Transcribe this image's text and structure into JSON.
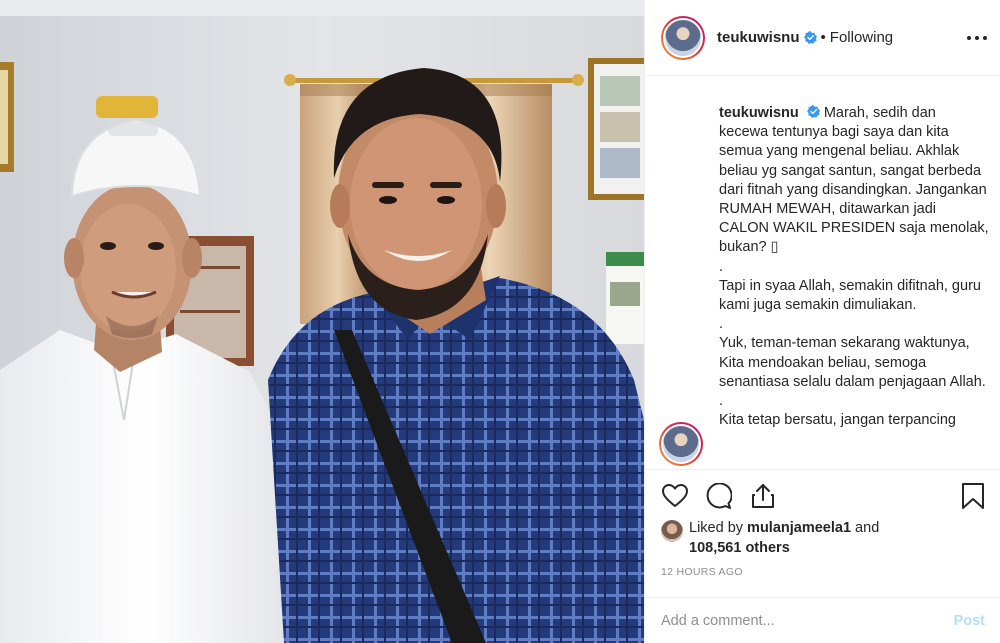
{
  "post": {
    "username": "teukuwisnu",
    "follow_separator": "•",
    "follow_status": "Following",
    "more_icon": "more-options-icon"
  },
  "caption": {
    "username": "teukuwisnu",
    "text_1": "Marah, sedih dan kecewa tentunya bagi saya dan kita semua yang mengenal beliau. Akhlak beliau yg sangat santun, sangat berbeda dari fitnah yang disandingkan. Jangankan RUMAH MEWAH, ditawarkan jadi CALON WAKIL PRESIDEN saja menolak, bukan? ▯",
    "dot_1": ".",
    "text_2": "Tapi in syaa Allah, semakin difitnah, guru kami juga semakin dimuliakan.",
    "dot_2": ".",
    "text_3": "Yuk, teman-teman sekarang waktunya, Kita mendoakan beliau, semoga senantiasa selalu dalam penjagaan Allah.",
    "dot_3": ".",
    "text_4": "Kita tetap bersatu, jangan terpancing"
  },
  "actions": {
    "like_icon": "heart-icon",
    "comment_icon": "comment-icon",
    "share_icon": "share-icon",
    "save_icon": "bookmark-icon"
  },
  "likes": {
    "prefix": "Liked by ",
    "liker": "mulanjameela1",
    "and": " and",
    "others": "108,561 others"
  },
  "timestamp": "12 HOURS AGO",
  "comment": {
    "placeholder": "Add a comment...",
    "post_label": "Post"
  },
  "colors": {
    "verified_blue": "#3897f0",
    "post_button": "#b2dffc",
    "muted": "#8e8e8e"
  }
}
